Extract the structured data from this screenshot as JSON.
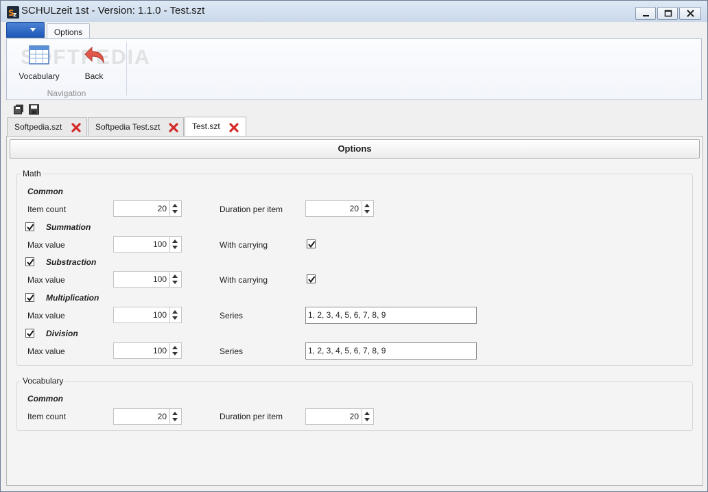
{
  "window": {
    "title": "SCHULzeit 1st - Version: 1.1.0 - Test.szt",
    "app_icon": "sz-logo-icon"
  },
  "ribbon": {
    "tab": "Options",
    "buttons": [
      {
        "label": "Vocabulary",
        "icon": "table-icon"
      },
      {
        "label": "Back",
        "icon": "undo-arrow-icon"
      }
    ],
    "group_label": "Navigation",
    "watermark": "SOFTPEDIA"
  },
  "quick_toolbar": [
    {
      "icon": "save-all-icon"
    },
    {
      "icon": "save-icon"
    }
  ],
  "doc_tabs": [
    {
      "label": "Softpedia.szt",
      "active": false
    },
    {
      "label": "Softpedia Test.szt",
      "active": false
    },
    {
      "label": "Test.szt",
      "active": true
    }
  ],
  "panel": {
    "header": "Options",
    "math": {
      "label": "Math",
      "common": {
        "title": "Common",
        "item_count_label": "Item count",
        "item_count": "20",
        "duration_label": "Duration per item",
        "duration": "20"
      },
      "summation": {
        "title": "Summation",
        "enabled": true,
        "max_label": "Max value",
        "max": "100",
        "carry_label": "With carrying",
        "carry": true
      },
      "substraction": {
        "title": "Substraction",
        "enabled": true,
        "max_label": "Max value",
        "max": "100",
        "carry_label": "With carrying",
        "carry": true
      },
      "multiplication": {
        "title": "Multiplication",
        "enabled": true,
        "max_label": "Max value",
        "max": "100",
        "series_label": "Series",
        "series": "1, 2, 3, 4, 5, 6, 7, 8, 9"
      },
      "division": {
        "title": "Division",
        "enabled": true,
        "max_label": "Max value",
        "max": "100",
        "series_label": "Series",
        "series": "1, 2, 3, 4, 5, 6, 7, 8, 9"
      }
    },
    "vocabulary": {
      "label": "Vocabulary",
      "common": {
        "title": "Common",
        "item_count_label": "Item count",
        "item_count": "20",
        "duration_label": "Duration per item",
        "duration": "20"
      }
    }
  },
  "colors": {
    "accent": "#2a62bf",
    "close_x": "#d42a2a",
    "titlebar": "#c9d8ea"
  }
}
